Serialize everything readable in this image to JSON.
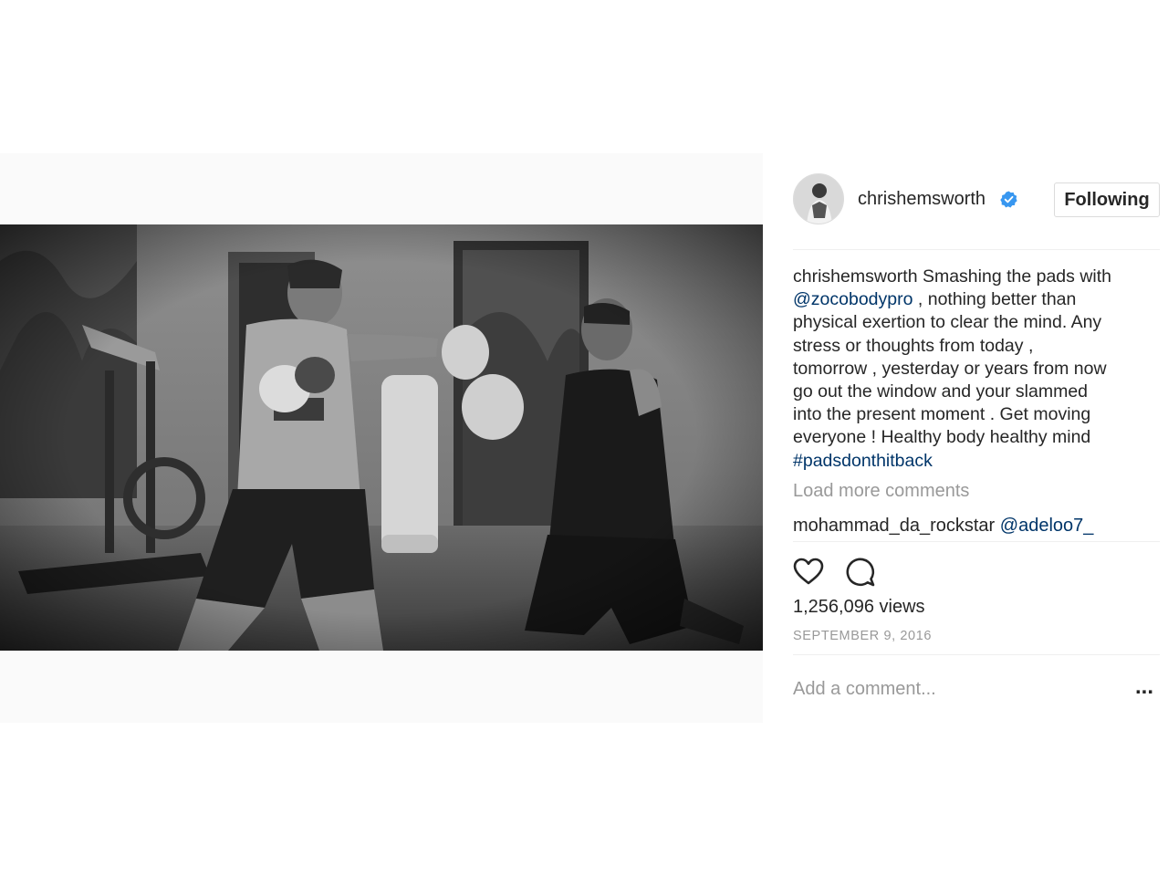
{
  "post": {
    "media": {
      "type": "video",
      "description_icon": "video-player"
    },
    "header": {
      "username": "chrishemsworth",
      "verified": true,
      "follow_label": "Following"
    },
    "caption": {
      "username": "chrishemsworth",
      "lines": [
        " Smashing the pads with",
        " , nothing better than",
        "physical exertion to clear the mind. Any",
        "stress or thoughts from today ,",
        "tomorrow , yesterday or years from now",
        "go out the window and your slammed",
        "into the present moment . Get moving",
        "everyone ! Healthy body healthy mind"
      ],
      "mention": "@zocobodypro",
      "hashtag": "#padsdonthitback"
    },
    "load_more_label": "Load more comments",
    "comments": [
      {
        "username": "mohammad_da_rockstar",
        "text": "@adeloo7_"
      }
    ],
    "actions": {
      "like_icon": "heart-icon",
      "comment_icon": "comment-icon"
    },
    "views": "1,256,096 views",
    "date": "SEPTEMBER 9, 2016",
    "add_comment_placeholder": "Add a comment...",
    "more_label": "..."
  },
  "colors": {
    "link": "#003569",
    "muted": "#999999",
    "text": "#262626",
    "verified": "#3897f0",
    "divider": "#efefef"
  }
}
